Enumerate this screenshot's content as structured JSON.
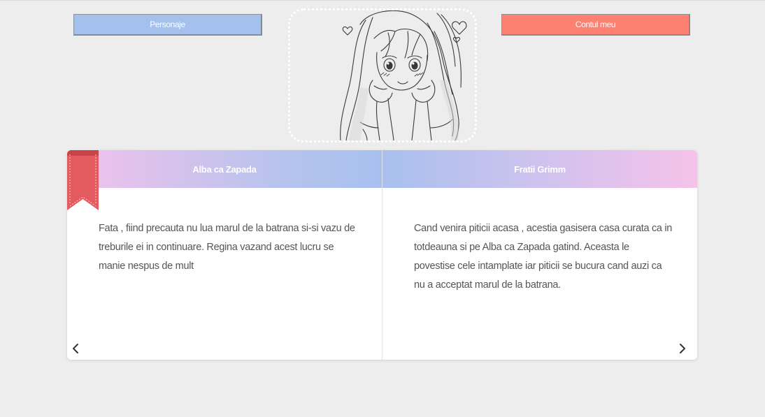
{
  "nav": {
    "left_button": "Personaje",
    "right_button": "Contul meu",
    "left_color": "#a4c1ee",
    "right_color": "#fd8070"
  },
  "avatar": {
    "icon": "sketch-anime-girl-avatar"
  },
  "cards": [
    {
      "title": "Alba ca Zapada",
      "text": "Fata , fiind precauta nu lua marul de la batrana si-si vazu de treburile ei in continuare. Regina vazand acest lucru se manie nespus de mult",
      "ribbon_color": "#e35a5f"
    },
    {
      "title": "Fratii Grimm",
      "text": "Cand venira piticii acasa , acestia gasisera casa curata ca in totdeauna si pe Alba ca Zapada gatind. Aceasta le povestise cele intamplate iar piticii se bucura cand auzi ca nu a acceptat marul de la batrana."
    }
  ],
  "carousel": {
    "prev_icon": "chevron-left-icon",
    "next_icon": "chevron-right-icon"
  }
}
